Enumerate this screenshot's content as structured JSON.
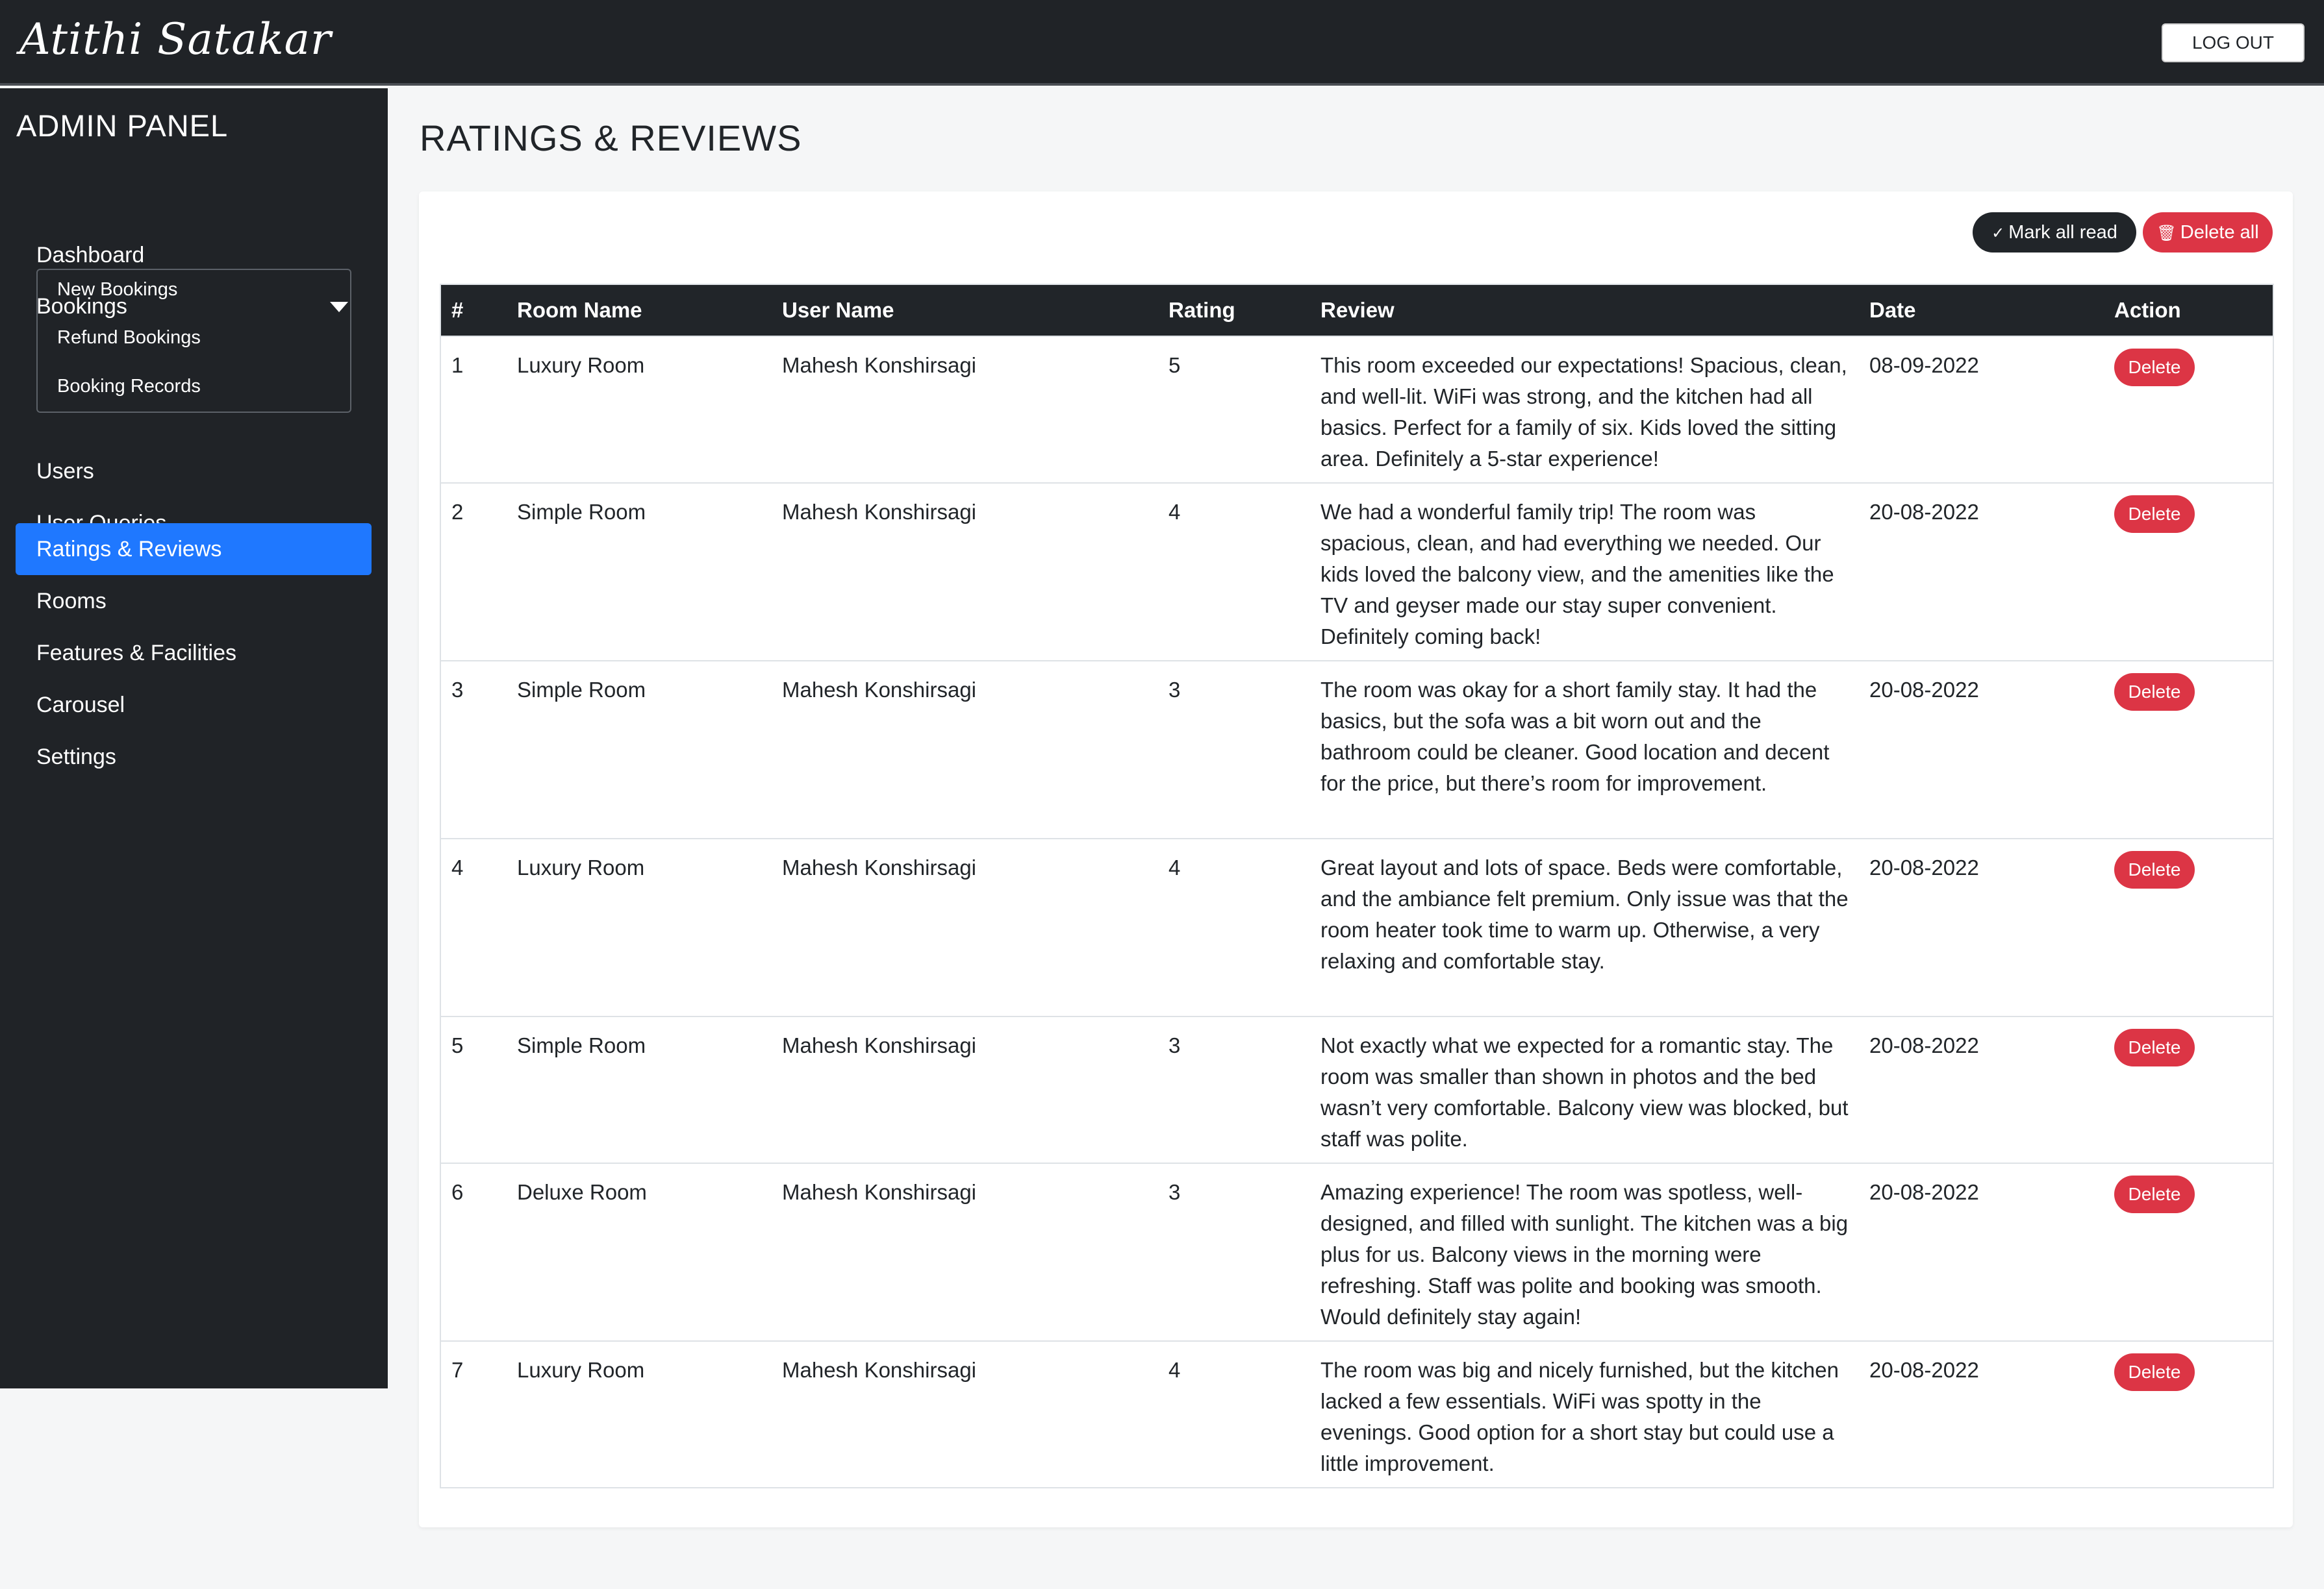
{
  "header": {
    "brand": "Atithi Satakar",
    "logout_label": "LOG OUT"
  },
  "sidebar": {
    "title": "ADMIN PANEL",
    "items": [
      {
        "label": "Dashboard"
      },
      {
        "label": "Bookings"
      },
      {
        "label": "Users"
      },
      {
        "label": "User Queries"
      },
      {
        "label": "Ratings & Reviews"
      },
      {
        "label": "Rooms"
      },
      {
        "label": "Features & Facilities"
      },
      {
        "label": "Carousel"
      },
      {
        "label": "Settings"
      }
    ],
    "bookings_submenu": [
      {
        "label": "New Bookings"
      },
      {
        "label": "Refund Bookings"
      },
      {
        "label": "Booking Records"
      }
    ],
    "active_item": "Ratings & Reviews"
  },
  "main": {
    "title": "RATINGS & REVIEWS",
    "mark_all_read_label": "Mark all read",
    "delete_all_label": "Delete all",
    "table": {
      "columns": [
        "#",
        "Room Name",
        "User Name",
        "Rating",
        "Review",
        "Date",
        "Action"
      ],
      "delete_label": "Delete",
      "rows": [
        {
          "num": "1",
          "room": "Luxury Room",
          "user": "Mahesh Konshirsagi",
          "rating": "5",
          "review": "This room exceeded our expectations! Spacious, clean, and well-lit. WiFi was strong, and the kitchen had all basics. Perfect for a family of six. Kids loved the sitting area. Definitely a 5-star experience!",
          "date": "08-09-2022"
        },
        {
          "num": "2",
          "room": "Simple Room",
          "user": "Mahesh Konshirsagi",
          "rating": "4",
          "review": "We had a wonderful family trip! The room was spacious, clean, and had everything we needed. Our kids loved the balcony view, and the amenities like the TV and geyser made our stay super convenient. Definitely coming back!",
          "date": "20-08-2022"
        },
        {
          "num": "3",
          "room": "Simple Room",
          "user": "Mahesh Konshirsagi",
          "rating": "3",
          "review": "The room was okay for a short family stay. It had the basics, but the sofa was a bit worn out and the bathroom could be cleaner. Good location and decent for the price, but there’s room for improvement.",
          "date": "20-08-2022"
        },
        {
          "num": "4",
          "room": "Luxury Room",
          "user": "Mahesh Konshirsagi",
          "rating": "4",
          "review": "Great layout and lots of space. Beds were comfortable, and the ambiance felt premium. Only issue was that the room heater took time to warm up. Otherwise, a very relaxing and comfortable stay.",
          "date": "20-08-2022"
        },
        {
          "num": "5",
          "room": "Simple Room",
          "user": "Mahesh Konshirsagi",
          "rating": "3",
          "review": "Not exactly what we expected for a romantic stay. The room was smaller than shown in photos and the bed wasn’t very comfortable. Balcony view was blocked, but staff was polite.",
          "date": "20-08-2022"
        },
        {
          "num": "6",
          "room": "Deluxe Room",
          "user": "Mahesh Konshirsagi",
          "rating": "3",
          "review": "Amazing experience! The room was spotless, well-designed, and filled with sunlight. The kitchen was a big plus for us. Balcony views in the morning were refreshing. Staff was polite and booking was smooth. Would definitely stay again!",
          "date": "20-08-2022"
        },
        {
          "num": "7",
          "room": "Luxury Room",
          "user": "Mahesh Konshirsagi",
          "rating": "4",
          "review": "The room was big and nicely furnished, but the kitchen lacked a few essentials. WiFi was spotty in the evenings. Good option for a short stay but could use a little improvement.",
          "date": "20-08-2022"
        }
      ]
    }
  },
  "colors": {
    "topbar": "#202327",
    "sidebar": "#202327",
    "active_nav": "#1f78ff",
    "danger": "#dc3545",
    "dark_button": "#212529"
  }
}
